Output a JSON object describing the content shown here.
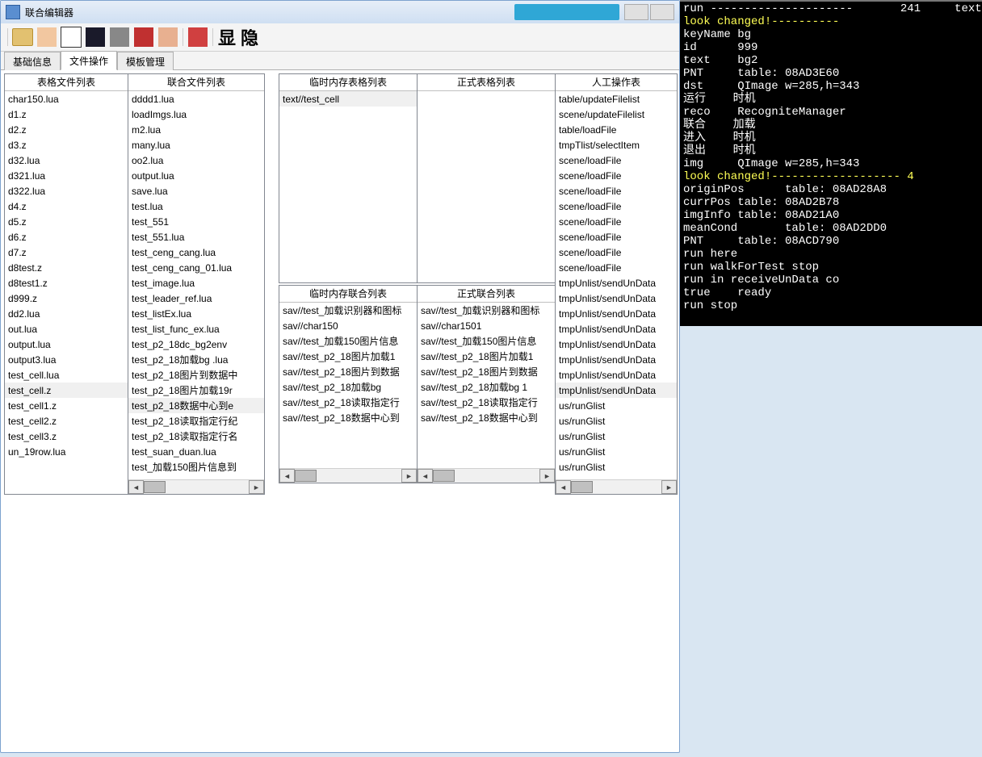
{
  "title": "联合编辑器",
  "toolbar": {
    "show": "显",
    "hide": "隐"
  },
  "tabs": [
    {
      "label": "基础信息"
    },
    {
      "label": "文件操作"
    },
    {
      "label": "模板管理"
    }
  ],
  "active_tab": 1,
  "panels": {
    "table_files": {
      "header": "表格文件列表",
      "selected": "test_cell.z",
      "items": [
        "char150.lua",
        "d1.z",
        "d2.z",
        "d3.z",
        "d32.lua",
        "d321.lua",
        "d322.lua",
        "d4.z",
        "d5.z",
        "d6.z",
        "d7.z",
        "d8test.z",
        "d8test1.z",
        "d999.z",
        "dd2.lua",
        "out.lua",
        "output.lua",
        "output3.lua",
        "test_cell.lua",
        "test_cell.z",
        "test_cell1.z",
        "test_cell2.z",
        "test_cell3.z",
        "un_19row.lua"
      ]
    },
    "union_files": {
      "header": "联合文件列表",
      "selected": "test_p2_18数据中心到e",
      "items": [
        "dddd1.lua",
        "loadImgs.lua",
        "m2.lua",
        "many.lua",
        "oo2.lua",
        "output.lua",
        "save.lua",
        "test.lua",
        "test_551",
        "test_551.lua",
        "test_ceng_cang.lua",
        "test_ceng_cang_01.lua",
        "test_image.lua",
        "test_leader_ref.lua",
        "test_listEx.lua",
        "test_list_func_ex.lua",
        "test_p2_18dc_bg2env",
        "test_p2_18加载bg .lua",
        "test_p2_18图片到数据中",
        "test_p2_18图片加载19r",
        "test_p2_18数据中心到e",
        "test_p2_18读取指定行纪",
        "test_p2_18读取指定行名",
        "test_suan_duan.lua",
        "test_加载150图片信息到"
      ]
    },
    "temp_table": {
      "header": "临时内存表格列表",
      "selected": "text//test_cell",
      "items": [
        "text//test_cell"
      ]
    },
    "temp_union": {
      "header": "临时内存联合列表",
      "items": [
        "sav//test_加载识别器和图标",
        "sav//char150",
        "sav//test_加载150图片信息",
        "sav//test_p2_18图片加载1",
        "sav//test_p2_18图片到数据",
        "sav//test_p2_18加载bg",
        "sav//test_p2_18读取指定行",
        "sav//test_p2_18数据中心到"
      ]
    },
    "official_table": {
      "header": "正式表格列表",
      "items": []
    },
    "official_union": {
      "header": "正式联合列表",
      "items": [
        "sav//test_加载识别器和图标",
        "sav//char1501",
        "sav//test_加载150图片信息",
        "sav//test_p2_18图片加载1",
        "sav//test_p2_18图片到数据",
        "sav//test_p2_18加载bg 1",
        "sav//test_p2_18读取指定行",
        "sav//test_p2_18数据中心到"
      ]
    },
    "manual": {
      "header": "人工操作表",
      "selected": "tmpUnlist/sendUnData",
      "items": [
        "table/updateFilelist",
        "scene/updateFilelist",
        "table/loadFile",
        "tmpTlist/selectItem",
        "scene/loadFile",
        "scene/loadFile",
        "scene/loadFile",
        "scene/loadFile",
        "scene/loadFile",
        "scene/loadFile",
        "scene/loadFile",
        "scene/loadFile",
        "tmpUnlist/sendUnData",
        "tmpUnlist/sendUnData",
        "tmpUnlist/sendUnData",
        "tmpUnlist/sendUnData",
        "tmpUnlist/sendUnData",
        "tmpUnlist/sendUnData",
        "tmpUnlist/sendUnData",
        "tmpUnlist/sendUnData",
        "us/runGlist",
        "us/runGlist",
        "us/runGlist",
        "us/runGlist",
        "us/runGlist"
      ]
    }
  },
  "console": [
    "run ---------------------       241     text",
    "look changed!----------",
    "keyName bg",
    "id      999",
    "text    bg2",
    "PNT     table: 08AD3E60",
    "dst     QImage w=285,h=343",
    "运行    时机",
    "reco    RecogniteManager",
    "联合    加载",
    "进入    时机",
    "退出    时机",
    "img     QImage w=285,h=343",
    "look changed!------------------- 4",
    "originPos      table: 08AD28A8",
    "currPos table: 08AD2B78",
    "imgInfo table: 08AD21A0",
    "meanCond       table: 08AD2DD0",
    "PNT     table: 08ACD790",
    "run here",
    "run walkForTest stop",
    "run in receiveUnData co",
    "true    ready",
    "run stop"
  ]
}
